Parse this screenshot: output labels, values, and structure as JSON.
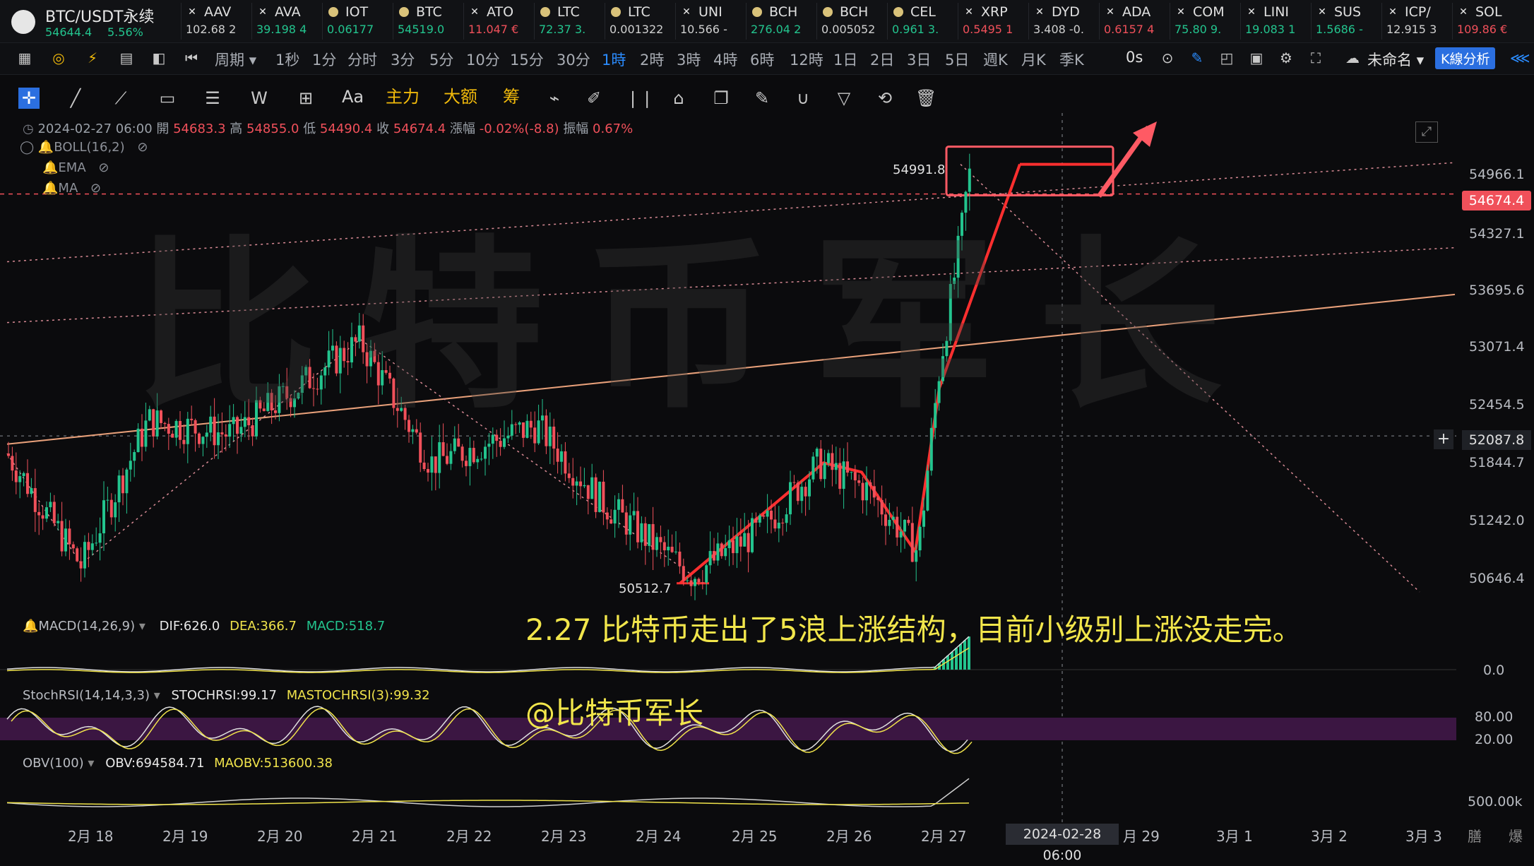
{
  "ticker_bar": {
    "main_symbol": "BTC/USDT永续",
    "main_price": "54644.4",
    "main_change": "5.56%",
    "tickers": [
      {
        "name": "AAV",
        "value": "102.68 2",
        "color": "#d0d0d0",
        "icon": "star-icon"
      },
      {
        "name": "AVA",
        "value": "39.198 4",
        "color": "#23c48e",
        "icon": "star-icon"
      },
      {
        "name": "IOT",
        "value": "0.06177",
        "color": "#23c48e",
        "icon": "coin-icon"
      },
      {
        "name": "BTC",
        "value": "54519.0",
        "color": "#23c48e",
        "icon": "coin-icon"
      },
      {
        "name": "ATO",
        "value": "11.047 €",
        "color": "#f0505a",
        "icon": "star-icon"
      },
      {
        "name": "LTC",
        "value": "72.37 3.",
        "color": "#23c48e",
        "icon": "coin-icon"
      },
      {
        "name": "LTC",
        "value": "0.001322",
        "color": "#d0d0d0",
        "icon": "coin-icon"
      },
      {
        "name": "UNI",
        "value": "10.566 -",
        "color": "#d0d0d0",
        "icon": "star-icon"
      },
      {
        "name": "BCH",
        "value": "276.04 2",
        "color": "#23c48e",
        "icon": "coin-icon"
      },
      {
        "name": "BCH",
        "value": "0.005052",
        "color": "#d0d0d0",
        "icon": "coin-icon"
      },
      {
        "name": "CEL",
        "value": "0.961 3.",
        "color": "#23c48e",
        "icon": "coin-icon"
      },
      {
        "name": "XRP",
        "value": "0.5495 1",
        "color": "#f0505a",
        "icon": "star-icon"
      },
      {
        "name": "DYD",
        "value": "3.408 -0.",
        "color": "#d0d0d0",
        "icon": "star-icon"
      },
      {
        "name": "ADA",
        "value": "0.6157 4",
        "color": "#f0505a",
        "icon": "star-icon"
      },
      {
        "name": "COM",
        "value": "75.80 9.",
        "color": "#23c48e",
        "icon": "star-icon"
      },
      {
        "name": "LINI",
        "value": "19.083 1",
        "color": "#23c48e",
        "icon": "star-icon"
      },
      {
        "name": "SUS",
        "value": "1.5686 -",
        "color": "#23c48e",
        "icon": "star-icon"
      },
      {
        "name": "ICP/",
        "value": "12.915 3",
        "color": "#d0d0d0",
        "icon": "star-icon"
      },
      {
        "name": "SOL",
        "value": "109.86 €",
        "color": "#f0505a",
        "icon": "star-icon"
      }
    ]
  },
  "period_bar": {
    "period_menu": "周期",
    "periods": [
      "1秒",
      "1分",
      "分时",
      "3分",
      "5分",
      "10分",
      "15分",
      "30分",
      "1時",
      "2時",
      "3時",
      "4時",
      "6時",
      "12時",
      "1日",
      "2日",
      "3日",
      "5日",
      "週K",
      "月K",
      "季K"
    ],
    "active_period": "1時",
    "countdown": "0s",
    "layout_name": "未命名",
    "k_analysis": "K線分析"
  },
  "drawing_bar": {
    "text_tool": "Aa",
    "main_force": "主力",
    "large_amount": "大额",
    "chips": "筹"
  },
  "chart_info": {
    "datetime": "2024-02-27 06:00",
    "open_label": "開",
    "open": "54683.3",
    "high_label": "高",
    "high": "54855.0",
    "low_label": "低",
    "low": "54490.4",
    "close_label": "收",
    "close": "54674.4",
    "change_label": "漲幅",
    "change": "-0.02%(-8.8)",
    "amp_label": "振幅",
    "amp": "0.67%",
    "boll": "BOLL(16,2)",
    "ema": "EMA",
    "ma": "MA"
  },
  "annotations": {
    "watermark": "比特币军长",
    "main_text": "2.27 比特币走出了5浪上涨结构，目前小级别上涨没走完。",
    "handle": "@比特币军长",
    "peak_label": "54991.8",
    "trough_label": "50512.7"
  },
  "price_axis": {
    "labels": [
      "54966.1",
      "54327.1",
      "53695.6",
      "53071.4",
      "52454.5",
      "51844.7",
      "51242.0",
      "50646.4"
    ],
    "current_price": "54674.4",
    "crosshair_price": "52087.8"
  },
  "indicators": {
    "macd": {
      "label": "MACD(14,26,9)",
      "dif": "DIF:626.0",
      "dea": "DEA:366.7",
      "macd": "MACD:518.7",
      "axis": "0.0"
    },
    "stochrsi": {
      "label": "StochRSI(14,14,3,3)",
      "stoch": "STOCHRSI:99.17",
      "ma": "MASTOCHRSI(3):99.32",
      "axis_hi": "80.00",
      "axis_lo": "20.00"
    },
    "obv": {
      "label": "OBV(100)",
      "obv": "OBV:694584.71",
      "maobv": "MAOBV:513600.38",
      "axis": "500.00k"
    }
  },
  "time_axis": {
    "labels": [
      "2月 18",
      "2月 19",
      "2月 20",
      "2月 21",
      "2月 22",
      "2月 23",
      "2月 24",
      "2月 25",
      "2月 26",
      "2月 27",
      "月 29",
      "3月 1",
      "3月 2",
      "3月 3"
    ],
    "crosshair_date": "2024-02-28 06:00",
    "footer_left": "膳",
    "footer_right": "爆"
  },
  "chart_data": {
    "type": "candlestick",
    "symbol": "BTC/USDT永续",
    "interval": "1時",
    "x": [
      "2月 18",
      "2月 19",
      "2月 20",
      "2月 21",
      "2月 22",
      "2月 23",
      "2月 24",
      "2月 25",
      "2月 26",
      "2月 27"
    ],
    "ylim": [
      50400,
      55100
    ],
    "annotated_points": [
      {
        "label": "peak",
        "value": 54991.8,
        "date": "2月 27"
      },
      {
        "label": "trough",
        "value": 50512.7,
        "date": "2月 24"
      }
    ],
    "wave_path_prices": [
      50512.7,
      51800,
      51500,
      50850,
      54991.8
    ],
    "colors": {
      "up": "#23c48e",
      "down": "#f0505a",
      "wave": "#ff2f2f",
      "trend": "#e8a07a"
    }
  }
}
